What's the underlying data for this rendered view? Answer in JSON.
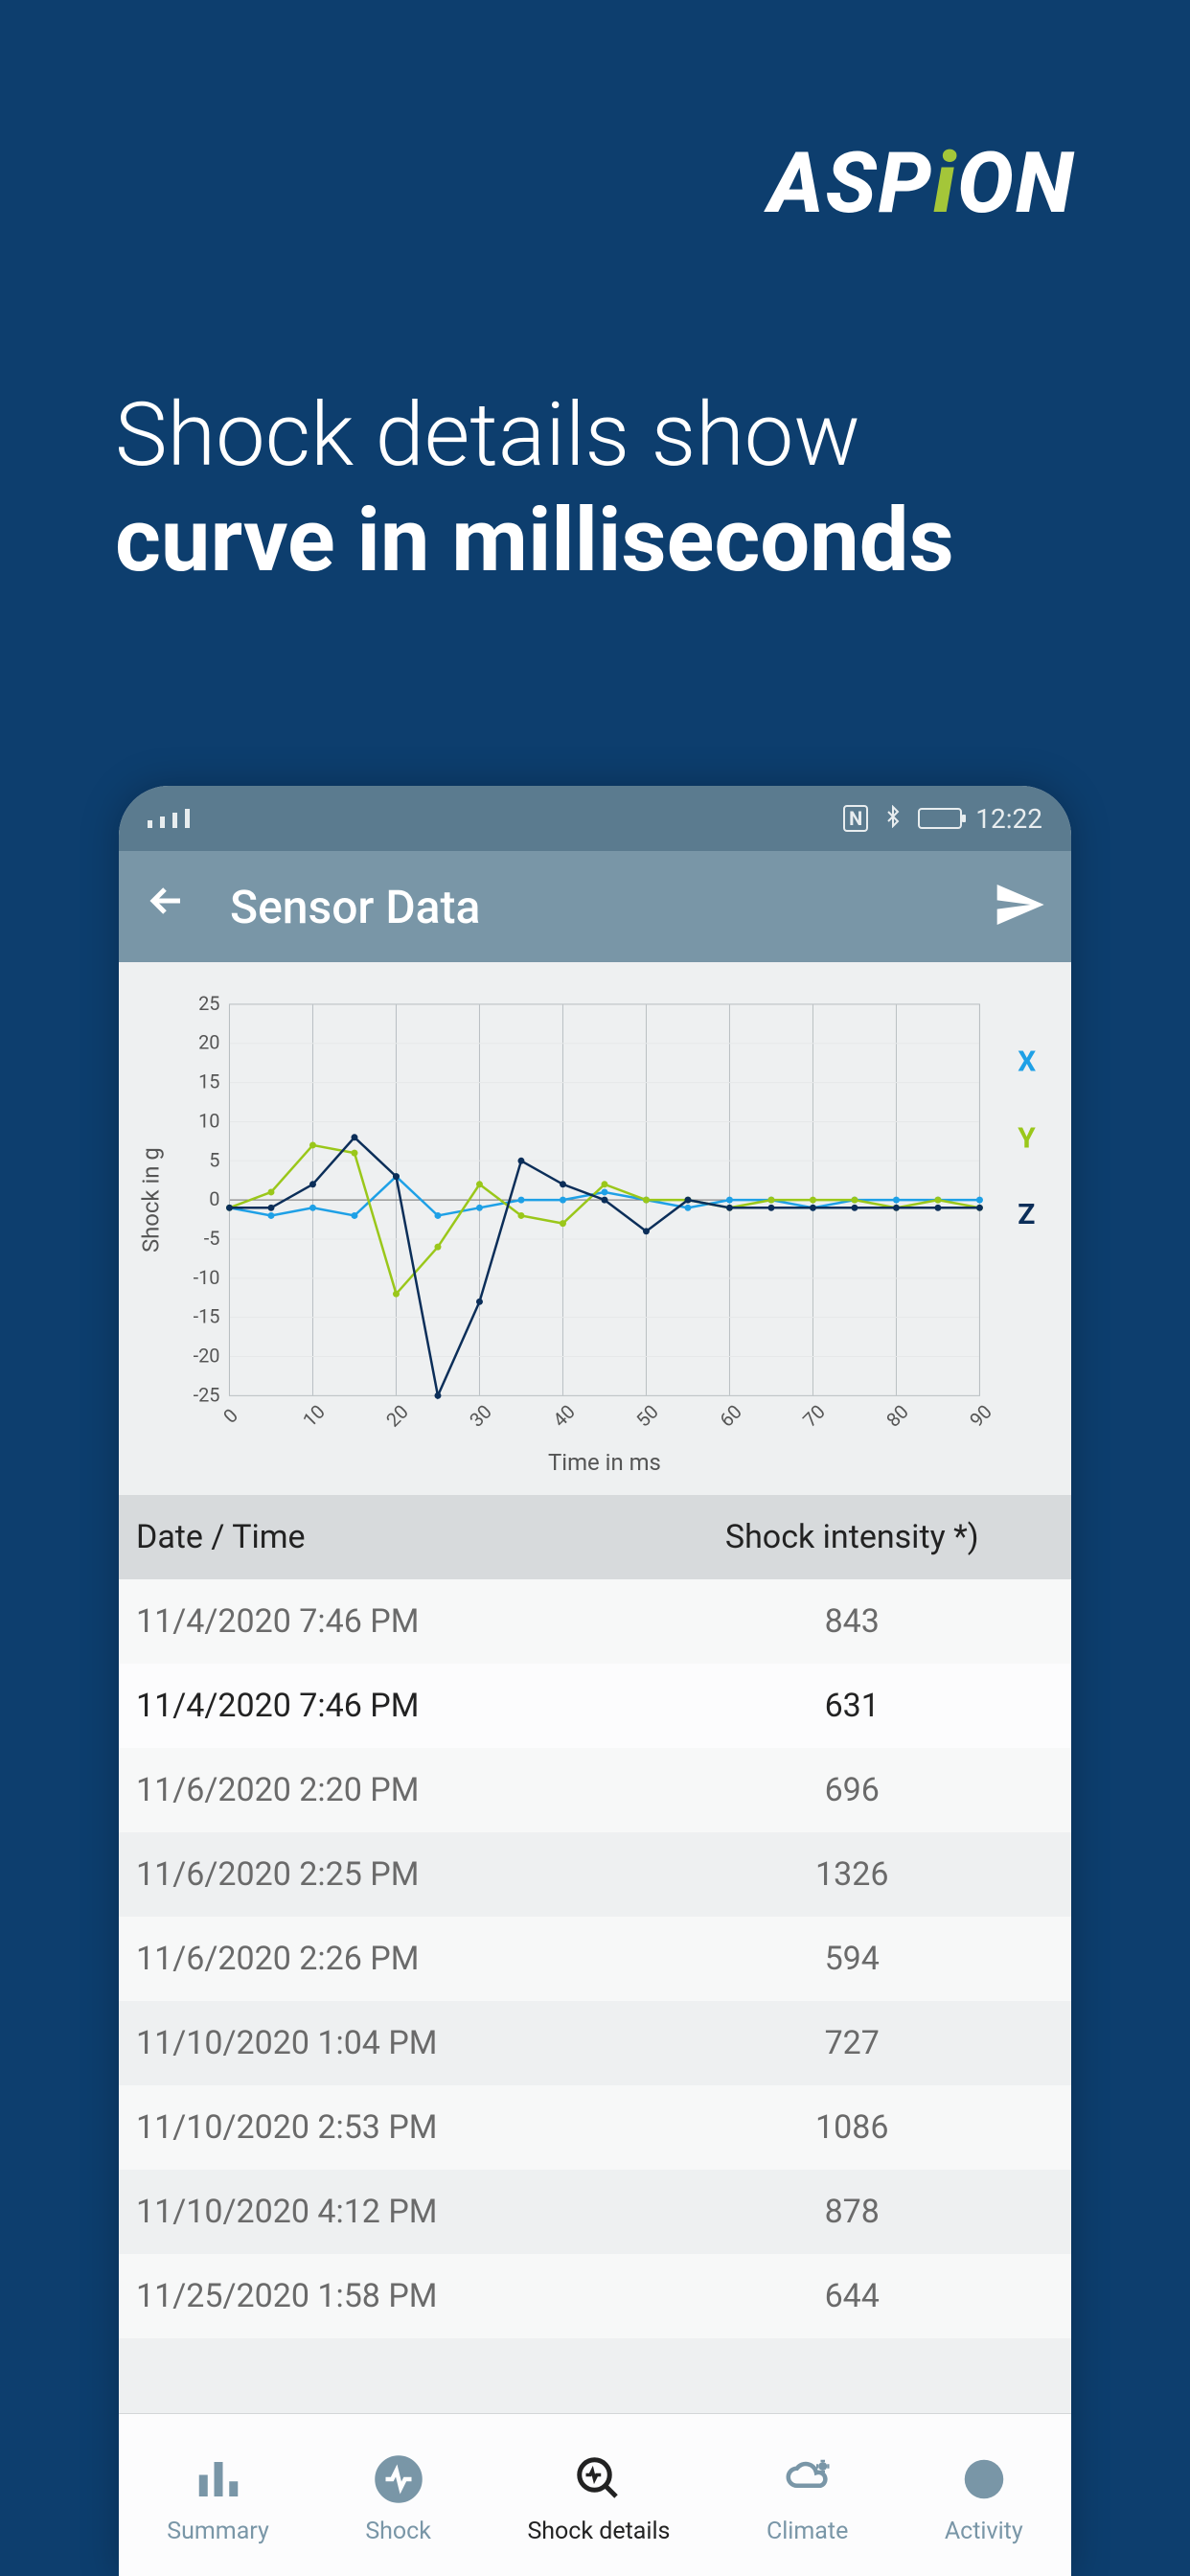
{
  "brand": {
    "name": "ASPiON"
  },
  "headline": {
    "line1": "Shock details show",
    "line2": "curve in milliseconds"
  },
  "status": {
    "time": "12:22"
  },
  "header": {
    "title": "Sensor Data"
  },
  "chart_data": {
    "type": "line",
    "title": "",
    "xlabel": "Time in ms",
    "ylabel": "Shock in g",
    "x": [
      0,
      5,
      10,
      15,
      20,
      25,
      30,
      35,
      40,
      45,
      50,
      55,
      60,
      65,
      70,
      75,
      80,
      85,
      90
    ],
    "x_ticks": [
      0,
      10,
      20,
      30,
      40,
      50,
      60,
      70,
      80,
      90
    ],
    "y_ticks": [
      -25,
      -20,
      -15,
      -10,
      -5,
      0,
      5,
      10,
      15,
      20,
      25
    ],
    "ylim": [
      -25,
      25
    ],
    "xlim": [
      0,
      90
    ],
    "series": [
      {
        "name": "X",
        "color": "#1ea0e6",
        "values": [
          -1,
          -2,
          -1,
          -2,
          3,
          -2,
          -1,
          0,
          0,
          1,
          0,
          -1,
          0,
          0,
          -1,
          0,
          0,
          0,
          0
        ]
      },
      {
        "name": "Y",
        "color": "#9ac71a",
        "values": [
          -1,
          1,
          7,
          6,
          -12,
          -6,
          2,
          -2,
          -3,
          2,
          0,
          0,
          -1,
          0,
          0,
          0,
          -1,
          0,
          -1
        ]
      },
      {
        "name": "Z",
        "color": "#0b2e59",
        "values": [
          -1,
          -1,
          2,
          8,
          3,
          -25,
          -13,
          5,
          2,
          0,
          -4,
          0,
          -1,
          -1,
          -1,
          -1,
          -1,
          -1,
          -1
        ]
      }
    ]
  },
  "table": {
    "header_date": "Date / Time",
    "header_intensity": "Shock intensity *)",
    "rows": [
      {
        "datetime": "11/4/2020 7:46 PM",
        "intensity": "843",
        "selected": false
      },
      {
        "datetime": "11/4/2020 7:46 PM",
        "intensity": "631",
        "selected": true
      },
      {
        "datetime": "11/6/2020 2:20 PM",
        "intensity": "696",
        "selected": false
      },
      {
        "datetime": "11/6/2020 2:25 PM",
        "intensity": "1326",
        "selected": false
      },
      {
        "datetime": "11/6/2020 2:26 PM",
        "intensity": "594",
        "selected": false
      },
      {
        "datetime": "11/10/2020 1:04 PM",
        "intensity": "727",
        "selected": false
      },
      {
        "datetime": "11/10/2020 2:53 PM",
        "intensity": "1086",
        "selected": false
      },
      {
        "datetime": "11/10/2020 4:12 PM",
        "intensity": "878",
        "selected": false
      },
      {
        "datetime": "11/25/2020 1:58 PM",
        "intensity": "644",
        "selected": false
      }
    ]
  },
  "nav": {
    "items": [
      {
        "id": "summary",
        "label": "Summary"
      },
      {
        "id": "shock",
        "label": "Shock"
      },
      {
        "id": "shock-details",
        "label": "Shock details",
        "active": true
      },
      {
        "id": "climate",
        "label": "Climate"
      },
      {
        "id": "activity",
        "label": "Activity"
      }
    ]
  }
}
